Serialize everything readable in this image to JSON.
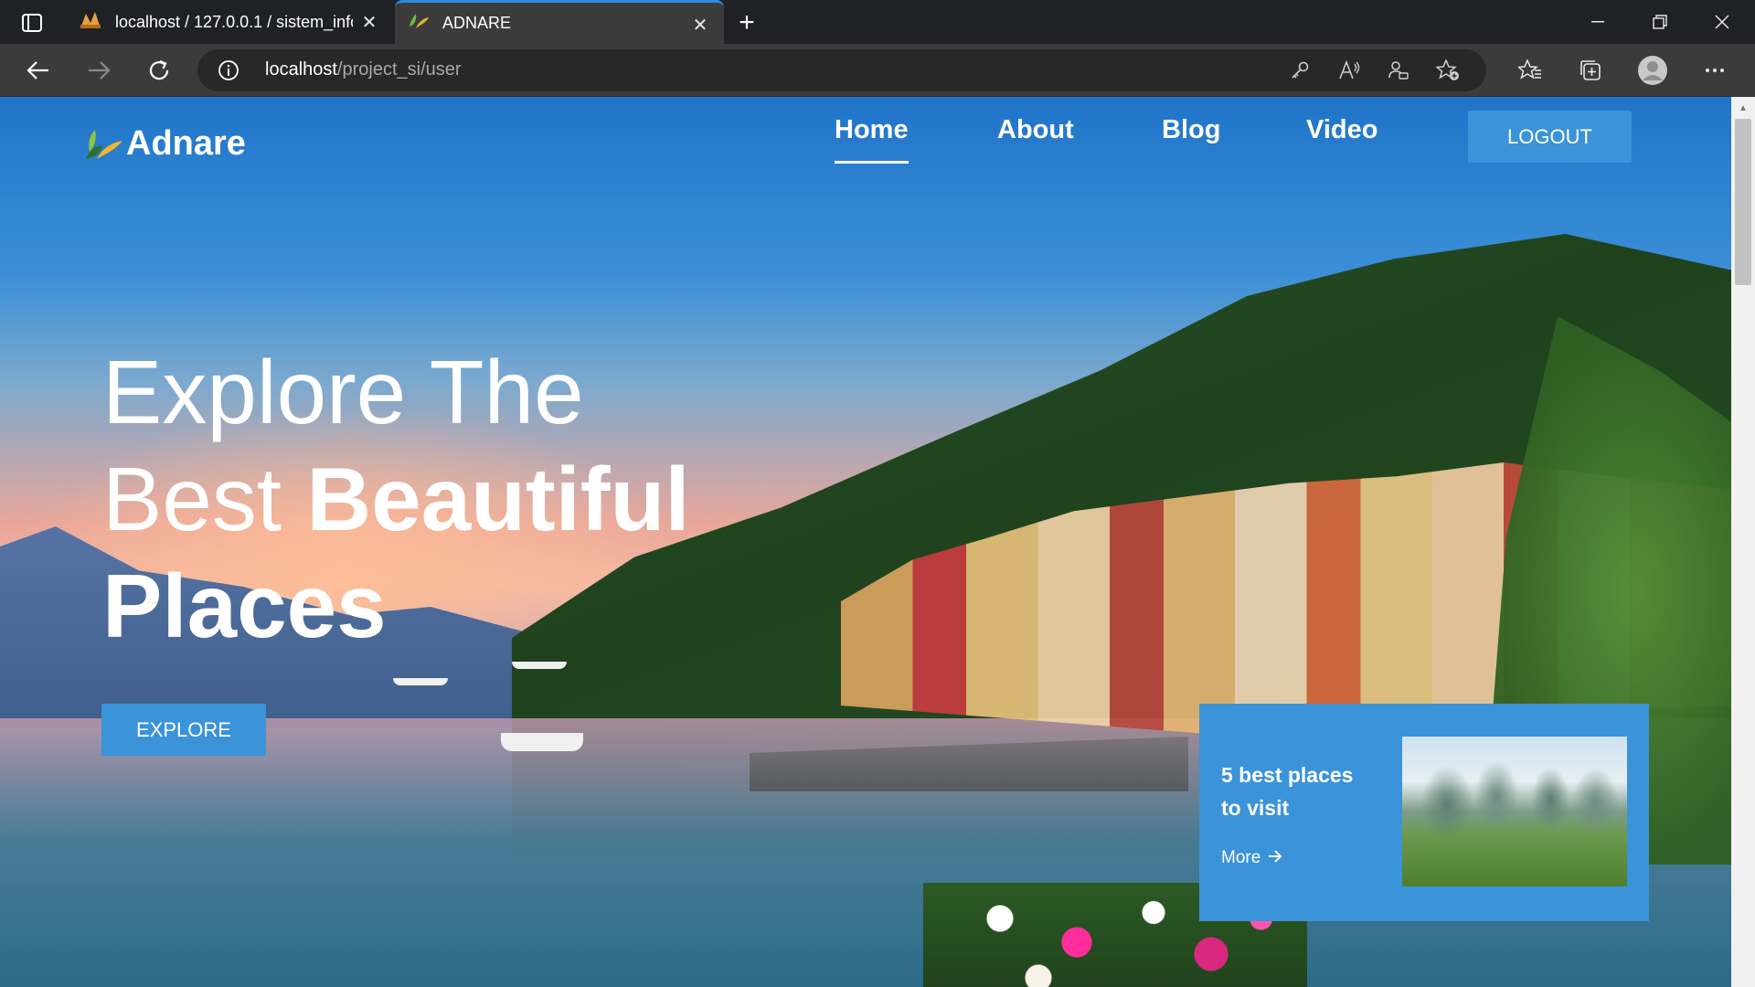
{
  "browser": {
    "tabs": [
      {
        "title": "localhost / 127.0.0.1 / sistem_info",
        "active": false
      },
      {
        "title": "ADNARE",
        "active": true
      }
    ],
    "url": {
      "host": "localhost",
      "path": "/project_si/user"
    },
    "accent": "#2e8ae0"
  },
  "site": {
    "brand": "Adnare",
    "nav": [
      {
        "label": "Home",
        "active": true
      },
      {
        "label": "About",
        "active": false
      },
      {
        "label": "Blog",
        "active": false
      },
      {
        "label": "Video",
        "active": false
      }
    ],
    "logout_label": "LOGOUT",
    "hero": {
      "line1": "Explore The",
      "line2_light": "Best ",
      "line2_bold": "Beautiful",
      "line3": "Places"
    },
    "explore_label": "EXPLORE",
    "card": {
      "text": "5 best places to visit",
      "more_label": "More"
    },
    "primary_color": "#3b93d9"
  }
}
